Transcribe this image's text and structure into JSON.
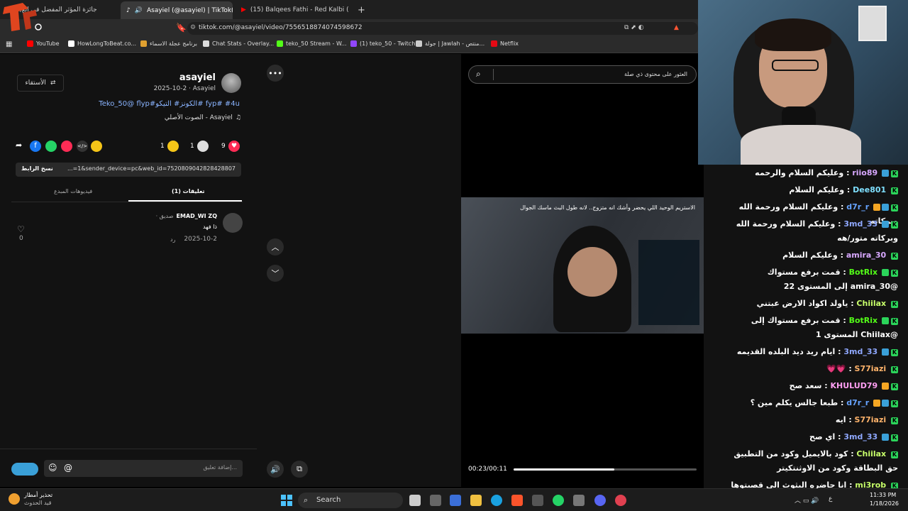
{
  "browser": {
    "tabs": [
      {
        "label": "(1)جائزة المؤثر المفضل في الع"
      },
      {
        "label": "Asayiel (@asayiel) | TikTok(1)"
      },
      {
        "label": "(15) Balqees Fathi - Red Kalbi (Offici"
      }
    ],
    "url": "tiktok.com/@asayiel/video/7556518874074598672",
    "bookmarks": [
      {
        "label": "YouTube",
        "color": "#ff0000"
      },
      {
        "label": "HowLongToBeat.co...",
        "color": "#ffffff"
      },
      {
        "label": "برنامج عجلة الاسماء",
        "color": "#e0a030"
      },
      {
        "label": "Chat Stats - Overlay...",
        "color": "#dddddd"
      },
      {
        "label": "teko_50 Stream - W...",
        "color": "#53fc18"
      },
      {
        "label": "(1) teko_50 - Twitch",
        "color": "#9146ff"
      },
      {
        "label": "جولة | Jawlah - منتص...",
        "color": "#cccccc"
      },
      {
        "label": "Netflix",
        "color": "#e50914"
      }
    ]
  },
  "post": {
    "username": "asayiel",
    "meta": "2025-10-2 · Asayiel",
    "caption": "Teko_50@ flyp#الكونز# التيكو# fyp# #4u",
    "sound": "الصوت الأصلي - Asayiel",
    "follow_label": "الأستقاء",
    "likes": "9",
    "comments": "1",
    "saves": "1",
    "copy_link_label": "نسخ الرابط",
    "link_value": "...=1&sender_device=pc&web_id=7520809042828428807",
    "tab_comments": "تعليقات (1)",
    "tab_creator_videos": "فيديوهات المبدع"
  },
  "comment": {
    "author": "EMAD_WI ZQ",
    "relation": "صديق ·",
    "text": "ذا فهد",
    "date": "2025-10-2",
    "reply": "رد",
    "like_count": "0"
  },
  "composer": {
    "placeholder": "إضافة تعليق..."
  },
  "video": {
    "search_placeholder": "العثور على محتوى ذي صلة",
    "overlay_text": "الاستريم الوحيد اللي يحضر وأشك انه متزوج.. لانه طول البث ماسك الجوال",
    "time": "00:23/00:11",
    "progress": 0.55
  },
  "chat": {
    "messages": [
      {
        "user": "riio89",
        "text": "وعليكم السلام والرحمه",
        "color": "#d8a8ff"
      },
      {
        "user": "Dee801",
        "text": "وعليكم السلام",
        "color": "#7fe0ff"
      },
      {
        "user": "d7r_r",
        "text": "وعليكم السلام ورحمة الله وبركاته",
        "color": "#66a3ff"
      },
      {
        "user": "3md_33",
        "text": "وعليكم السلام ورحمة الله وبركاته متور/هه",
        "color": "#8fa8ff"
      },
      {
        "user": "amira_30",
        "text": "وعليكم السلام",
        "color": "#d8a8ff"
      },
      {
        "user": "BotRix",
        "text": "قمت برفع مستواك @amira_30 إلى المستوى 22",
        "color": "#53fc18"
      },
      {
        "user": "Chiilax",
        "text": "ياولد اكواد الارض عبتني",
        "color": "#c8ff6a"
      },
      {
        "user": "BotRix",
        "text": "قمت برفع مستواك إلى @Chiilax المستوى 1",
        "color": "#53fc18"
      },
      {
        "user": "3md_33",
        "text": "ايام ريد ديد البلده القديمه",
        "color": "#8fa8ff"
      },
      {
        "user": "S77iazi",
        "text": "💗💗",
        "color": "#ffb36b"
      },
      {
        "user": "KHULUD79",
        "text": "سعد صح",
        "color": "#ff9ff3"
      },
      {
        "user": "d7r_r",
        "text": "طبعا جالس يكلم مين ؟",
        "color": "#66a3ff"
      },
      {
        "user": "S77iazi",
        "text": "ايه",
        "color": "#ffb36b"
      },
      {
        "user": "3md_33",
        "text": "اي صح",
        "color": "#8fa8ff"
      },
      {
        "user": "Chiilax",
        "text": "كود بالايميل وكود من التطبيق حق البطاقة وكود من الاوثنتكيتر",
        "color": "#c8ff6a"
      },
      {
        "user": "mi3rob",
        "text": "انا حاضره البثوث الي قصيتوها كلها واعرف ليش قام يقول كذا",
        "color": "#c8ff6a"
      }
    ]
  },
  "taskbar": {
    "weather_title": "تحذير أمطار",
    "weather_sub": "قيد الحدوث",
    "search_label": "Search",
    "time": "11:33 PM",
    "date": "1/18/2026",
    "lang": "ع"
  }
}
